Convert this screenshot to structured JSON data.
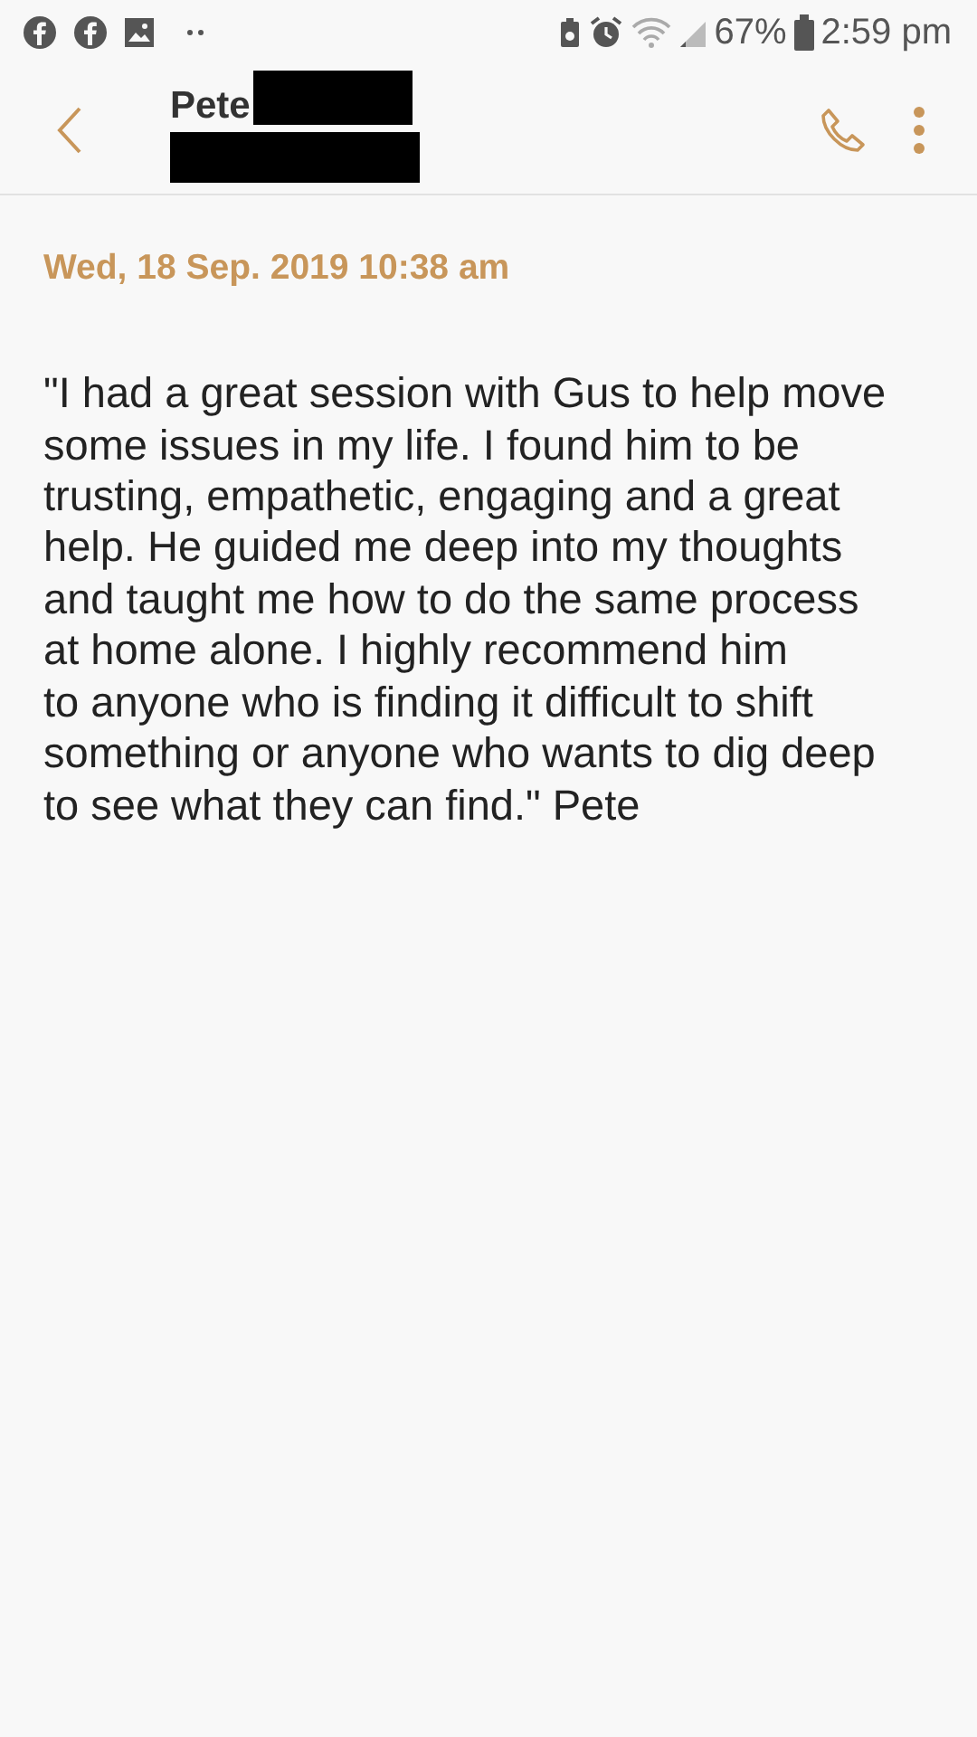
{
  "status_bar": {
    "battery": "67%",
    "time": "2:59 pm"
  },
  "header": {
    "contact_name": "Pete",
    "redacted": true
  },
  "message": {
    "date": "Wed, 18 Sep. 2019 10:38 am",
    "lines": [
      "\"I had a great session with Gus  to help move",
      "some issues in my life. I found him to be",
      "trusting, empathetic, engaging and a great",
      "help. He guided me deep into my thoughts",
      "and taught me how to do the same process",
      "at home alone. I highly recommend him",
      "to anyone who is finding it difficult to shift",
      "something or anyone who wants to dig deep",
      "to see what they can find.\" Pete"
    ]
  }
}
